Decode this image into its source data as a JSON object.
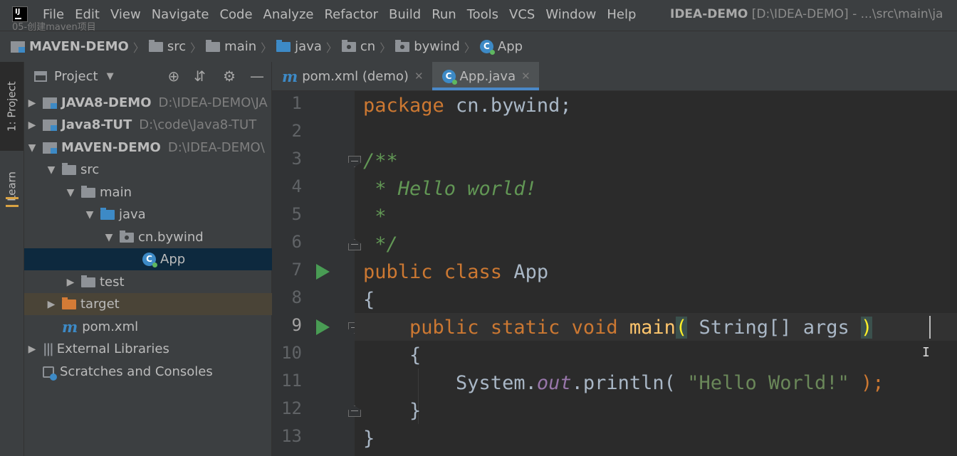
{
  "watermark": "05-创建maven项目",
  "menu": [
    "File",
    "Edit",
    "View",
    "Navigate",
    "Code",
    "Analyze",
    "Refactor",
    "Build",
    "Run",
    "Tools",
    "VCS",
    "Window",
    "Help"
  ],
  "window_title": {
    "project": "IDEA-DEMO",
    "path": "[D:\\IDEA-DEMO] - ...\\src\\main\\ja"
  },
  "breadcrumb": [
    "MAVEN-DEMO",
    "src",
    "main",
    "java",
    "cn",
    "bywind",
    "App"
  ],
  "tool_tabs": {
    "project": "1: Project",
    "learn": "Learn"
  },
  "panel": {
    "title": "Project"
  },
  "tree": [
    {
      "label": "JAVA8-DEMO",
      "path": "D:\\IDEA-DEMO\\JA",
      "bold": true
    },
    {
      "label": "Java8-TUT",
      "path": "D:\\code\\Java8-TUT",
      "bold": true
    },
    {
      "label": "MAVEN-DEMO",
      "path": "D:\\IDEA-DEMO\\",
      "bold": true
    },
    {
      "label": "src"
    },
    {
      "label": "main"
    },
    {
      "label": "java"
    },
    {
      "label": "cn.bywind"
    },
    {
      "label": "App"
    },
    {
      "label": "test"
    },
    {
      "label": "target"
    },
    {
      "label": "pom.xml"
    },
    {
      "label": "External Libraries"
    },
    {
      "label": "Scratches and Consoles"
    }
  ],
  "tabs": [
    {
      "label": "pom.xml (demo)",
      "active": false
    },
    {
      "label": "App.java",
      "active": true
    }
  ],
  "line_numbers": [
    "1",
    "2",
    "3",
    "4",
    "5",
    "6",
    "7",
    "8",
    "9",
    "10",
    "11",
    "12",
    "13"
  ],
  "code": {
    "l1_kw": "package",
    "l1_rest": " cn.bywind;",
    "l3": "/**",
    "l4": " * Hello world!",
    "l5": " *",
    "l6": " */",
    "l7_kw": "public class",
    "l7_rest": " App",
    "l8": "{",
    "l9_indent": "    ",
    "l9_kw": "public static void",
    "l9_name": " main",
    "l9_open": "(",
    "l9_mid": " String[] args ",
    "l9_close": ")",
    "l10": "    {",
    "l11_pre": "        System.",
    "l11_field": "out",
    "l11_mid": ".println( ",
    "l11_str": "\"Hello World!\"",
    "l11_end": " );",
    "l12": "    }",
    "l13": "}"
  }
}
